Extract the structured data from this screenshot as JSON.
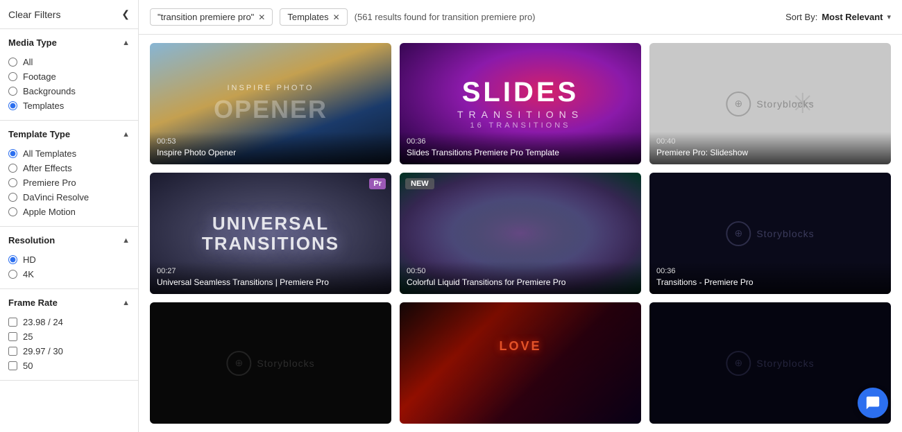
{
  "sidebar": {
    "clear_filters_label": "Clear Filters",
    "collapse_icon": "❮",
    "sections": [
      {
        "id": "media-type",
        "label": "Media Type",
        "expanded": true,
        "type": "radio",
        "options": [
          {
            "id": "all",
            "label": "All",
            "checked": false
          },
          {
            "id": "footage",
            "label": "Footage",
            "checked": false
          },
          {
            "id": "backgrounds",
            "label": "Backgrounds",
            "checked": false
          },
          {
            "id": "templates",
            "label": "Templates",
            "checked": true
          }
        ]
      },
      {
        "id": "template-type",
        "label": "Template Type",
        "expanded": true,
        "type": "radio",
        "options": [
          {
            "id": "all-templates",
            "label": "All Templates",
            "checked": true
          },
          {
            "id": "after-effects",
            "label": "After Effects",
            "checked": false
          },
          {
            "id": "premiere-pro",
            "label": "Premiere Pro",
            "checked": false
          },
          {
            "id": "davinci-resolve",
            "label": "DaVinci Resolve",
            "checked": false
          },
          {
            "id": "apple-motion",
            "label": "Apple Motion",
            "checked": false
          }
        ]
      },
      {
        "id": "resolution",
        "label": "Resolution",
        "expanded": true,
        "type": "radio",
        "options": [
          {
            "id": "hd",
            "label": "HD",
            "checked": true
          },
          {
            "id": "4k",
            "label": "4K",
            "checked": false
          }
        ]
      },
      {
        "id": "frame-rate",
        "label": "Frame Rate",
        "expanded": true,
        "type": "checkbox",
        "options": [
          {
            "id": "23.98",
            "label": "23.98 / 24",
            "checked": false
          },
          {
            "id": "25",
            "label": "25",
            "checked": false
          },
          {
            "id": "29.97",
            "label": "29.97 / 30",
            "checked": false
          },
          {
            "id": "50",
            "label": "50",
            "checked": false
          }
        ]
      }
    ]
  },
  "header": {
    "filters": [
      {
        "id": "query",
        "label": "\"transition premiere pro\""
      },
      {
        "id": "type",
        "label": "Templates"
      }
    ],
    "results_count": "(561 results found for transition premiere pro)",
    "sort_by_label": "Sort By:",
    "sort_value": "Most Relevant",
    "sort_chevron": "▾"
  },
  "grid": {
    "cards": [
      {
        "id": "card-1",
        "duration": "00:53",
        "title": "Inspire Photo Opener",
        "style": "opener",
        "badge": null
      },
      {
        "id": "card-2",
        "duration": "00:36",
        "title": "Slides Transitions Premiere Pro Template",
        "style": "slides",
        "badge": null
      },
      {
        "id": "card-3",
        "duration": "00:40",
        "title": "Premiere Pro: Slideshow",
        "style": "storyblocks",
        "badge": null
      },
      {
        "id": "card-4",
        "duration": "00:27",
        "title": "Universal Seamless Transitions | Premiere Pro",
        "style": "universal",
        "badge": "pr"
      },
      {
        "id": "card-5",
        "duration": "00:50",
        "title": "Colorful Liquid Transitions for Premiere Pro",
        "style": "colorful",
        "badge": "NEW"
      },
      {
        "id": "card-6",
        "duration": "00:36",
        "title": "Transitions - Premiere Pro",
        "style": "storyblocks-dark",
        "badge": null
      },
      {
        "id": "card-7",
        "duration": "",
        "title": "",
        "style": "storyblocks-dark2",
        "badge": null
      },
      {
        "id": "card-8",
        "duration": "",
        "title": "",
        "style": "city",
        "badge": null
      },
      {
        "id": "card-9",
        "duration": "",
        "title": "",
        "style": "storyblocks-dark3",
        "badge": null
      }
    ]
  },
  "chat": {
    "icon": "💬"
  }
}
